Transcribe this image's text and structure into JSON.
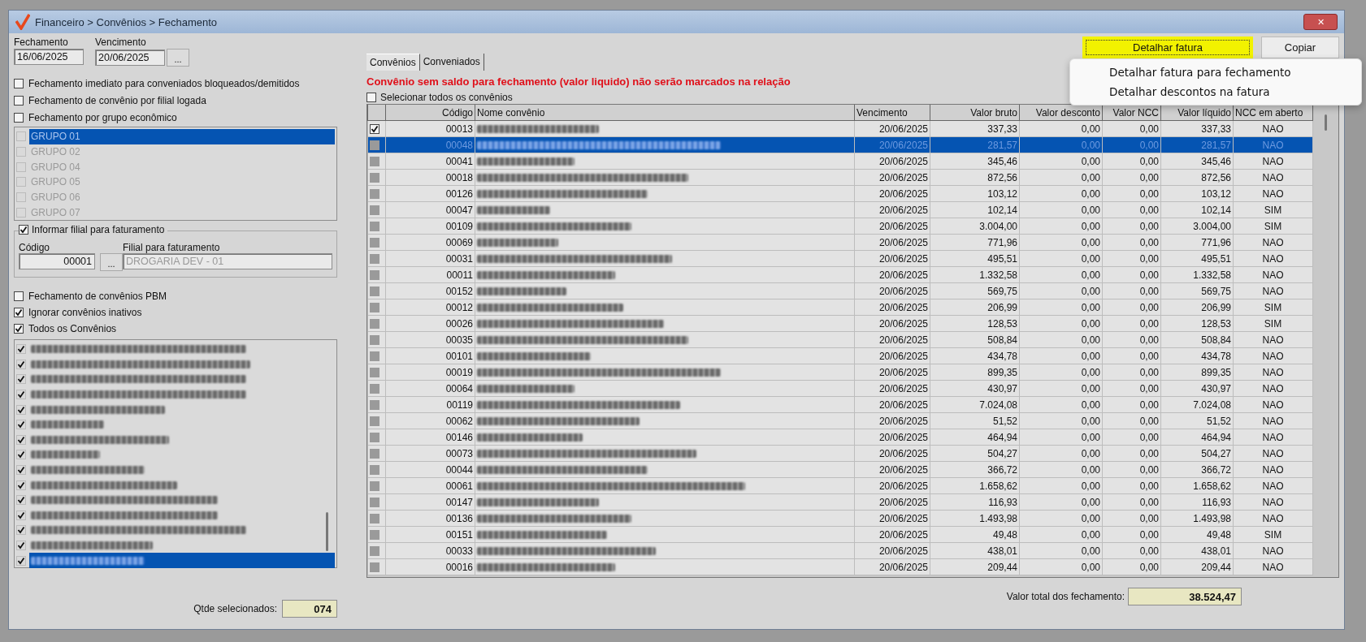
{
  "window": {
    "title": "Financeiro > Convênios > Fechamento",
    "close": "✕"
  },
  "dates": [
    {
      "label": "Fechamento",
      "value": "16/06/2025",
      "has_button": false
    },
    {
      "label": "Vencimento",
      "value": "20/06/2025",
      "has_button": true,
      "button": "..."
    }
  ],
  "options_top": [
    {
      "label": "Fechamento imediato para conveniados bloqueados/demitidos",
      "checked": false
    },
    {
      "label": "Fechamento de convênio por filial logada",
      "checked": false
    },
    {
      "label": "Fechamento por grupo econômico",
      "checked": false
    }
  ],
  "groups": [
    {
      "label": "GRUPO 01",
      "checked": false,
      "selected": true
    },
    {
      "label": "GRUPO 02",
      "checked": false,
      "selected": false
    },
    {
      "label": "GRUPO 04",
      "checked": false,
      "selected": false
    },
    {
      "label": "GRUPO 05",
      "checked": false,
      "selected": false
    },
    {
      "label": "GRUPO 06",
      "checked": false,
      "selected": false
    },
    {
      "label": "GRUPO 07",
      "checked": false,
      "selected": false
    }
  ],
  "filial": {
    "title": "Informar filial para faturamento",
    "checked": true,
    "code_label": "Código",
    "code": "00001",
    "button": "...",
    "name_label": "Filial para faturamento",
    "name": "DROGARIA DEV - 01"
  },
  "options_bottom": [
    {
      "label": "Fechamento de convênios PBM",
      "checked": false
    },
    {
      "label": "Ignorar convênios inativos",
      "checked": true
    },
    {
      "label": "Todos os Convênios",
      "checked": true
    }
  ],
  "convenios_list": [
    {
      "checked": true,
      "selected": false
    },
    {
      "checked": true,
      "selected": false
    },
    {
      "checked": true,
      "selected": false
    },
    {
      "checked": true,
      "selected": false
    },
    {
      "checked": true,
      "selected": false
    },
    {
      "checked": true,
      "selected": false
    },
    {
      "checked": true,
      "selected": false
    },
    {
      "checked": true,
      "selected": false
    },
    {
      "checked": true,
      "selected": false
    },
    {
      "checked": true,
      "selected": false
    },
    {
      "checked": true,
      "selected": false
    },
    {
      "checked": true,
      "selected": false
    },
    {
      "checked": true,
      "selected": false
    },
    {
      "checked": true,
      "selected": false
    },
    {
      "checked": true,
      "selected": true
    }
  ],
  "selected_count": {
    "label": "Qtde selecionados:",
    "value": "074"
  },
  "tabs": [
    {
      "label": "Convênios",
      "selected": true
    },
    {
      "label": "Conveniados",
      "selected": false
    }
  ],
  "buttons": [
    {
      "label": "Detalhar fatura",
      "kind": "highlight"
    },
    {
      "label": "Copiar",
      "kind": "normal"
    }
  ],
  "menu": [
    "Detalhar fatura para fechamento",
    "Detalhar descontos na fatura"
  ],
  "warning": "Convênio sem saldo para fechamento (valor liquido) não serão marcados na relação",
  "select_all": {
    "label": "Selecionar todos os convênios",
    "checked": false
  },
  "table": {
    "columns": [
      "Código",
      "Nome convênio",
      "Vencimento",
      "Valor bruto",
      "Valor desconto",
      "Valor NCC",
      "Valor líquido",
      "NCC em aberto"
    ],
    "rows": [
      {
        "code": "00013",
        "due": "20/06/2025",
        "gross": "337,33",
        "discount": "0,00",
        "ncc": "0,00",
        "net": "337,33",
        "open": "NAO",
        "checked": true,
        "selected": false
      },
      {
        "code": "00048",
        "due": "20/06/2025",
        "gross": "281,57",
        "discount": "0,00",
        "ncc": "0,00",
        "net": "281,57",
        "open": "NAO",
        "checked": false,
        "selected": true
      },
      {
        "code": "00041",
        "due": "20/06/2025",
        "gross": "345,46",
        "discount": "0,00",
        "ncc": "0,00",
        "net": "345,46",
        "open": "NAO",
        "checked": false,
        "selected": false
      },
      {
        "code": "00018",
        "due": "20/06/2025",
        "gross": "872,56",
        "discount": "0,00",
        "ncc": "0,00",
        "net": "872,56",
        "open": "NAO",
        "checked": false,
        "selected": false
      },
      {
        "code": "00126",
        "due": "20/06/2025",
        "gross": "103,12",
        "discount": "0,00",
        "ncc": "0,00",
        "net": "103,12",
        "open": "NAO",
        "checked": false,
        "selected": false
      },
      {
        "code": "00047",
        "due": "20/06/2025",
        "gross": "102,14",
        "discount": "0,00",
        "ncc": "0,00",
        "net": "102,14",
        "open": "SIM",
        "checked": false,
        "selected": false
      },
      {
        "code": "00109",
        "due": "20/06/2025",
        "gross": "3.004,00",
        "discount": "0,00",
        "ncc": "0,00",
        "net": "3.004,00",
        "open": "SIM",
        "checked": false,
        "selected": false
      },
      {
        "code": "00069",
        "due": "20/06/2025",
        "gross": "771,96",
        "discount": "0,00",
        "ncc": "0,00",
        "net": "771,96",
        "open": "NAO",
        "checked": false,
        "selected": false
      },
      {
        "code": "00031",
        "due": "20/06/2025",
        "gross": "495,51",
        "discount": "0,00",
        "ncc": "0,00",
        "net": "495,51",
        "open": "NAO",
        "checked": false,
        "selected": false
      },
      {
        "code": "00011",
        "due": "20/06/2025",
        "gross": "1.332,58",
        "discount": "0,00",
        "ncc": "0,00",
        "net": "1.332,58",
        "open": "NAO",
        "checked": false,
        "selected": false
      },
      {
        "code": "00152",
        "due": "20/06/2025",
        "gross": "569,75",
        "discount": "0,00",
        "ncc": "0,00",
        "net": "569,75",
        "open": "NAO",
        "checked": false,
        "selected": false
      },
      {
        "code": "00012",
        "due": "20/06/2025",
        "gross": "206,99",
        "discount": "0,00",
        "ncc": "0,00",
        "net": "206,99",
        "open": "SIM",
        "checked": false,
        "selected": false
      },
      {
        "code": "00026",
        "due": "20/06/2025",
        "gross": "128,53",
        "discount": "0,00",
        "ncc": "0,00",
        "net": "128,53",
        "open": "SIM",
        "checked": false,
        "selected": false
      },
      {
        "code": "00035",
        "due": "20/06/2025",
        "gross": "508,84",
        "discount": "0,00",
        "ncc": "0,00",
        "net": "508,84",
        "open": "NAO",
        "checked": false,
        "selected": false
      },
      {
        "code": "00101",
        "due": "20/06/2025",
        "gross": "434,78",
        "discount": "0,00",
        "ncc": "0,00",
        "net": "434,78",
        "open": "NAO",
        "checked": false,
        "selected": false
      },
      {
        "code": "00019",
        "due": "20/06/2025",
        "gross": "899,35",
        "discount": "0,00",
        "ncc": "0,00",
        "net": "899,35",
        "open": "NAO",
        "checked": false,
        "selected": false
      },
      {
        "code": "00064",
        "due": "20/06/2025",
        "gross": "430,97",
        "discount": "0,00",
        "ncc": "0,00",
        "net": "430,97",
        "open": "NAO",
        "checked": false,
        "selected": false
      },
      {
        "code": "00119",
        "due": "20/06/2025",
        "gross": "7.024,08",
        "discount": "0,00",
        "ncc": "0,00",
        "net": "7.024,08",
        "open": "NAO",
        "checked": false,
        "selected": false
      },
      {
        "code": "00062",
        "due": "20/06/2025",
        "gross": "51,52",
        "discount": "0,00",
        "ncc": "0,00",
        "net": "51,52",
        "open": "NAO",
        "checked": false,
        "selected": false
      },
      {
        "code": "00146",
        "due": "20/06/2025",
        "gross": "464,94",
        "discount": "0,00",
        "ncc": "0,00",
        "net": "464,94",
        "open": "NAO",
        "checked": false,
        "selected": false
      },
      {
        "code": "00073",
        "due": "20/06/2025",
        "gross": "504,27",
        "discount": "0,00",
        "ncc": "0,00",
        "net": "504,27",
        "open": "NAO",
        "checked": false,
        "selected": false
      },
      {
        "code": "00044",
        "due": "20/06/2025",
        "gross": "366,72",
        "discount": "0,00",
        "ncc": "0,00",
        "net": "366,72",
        "open": "NAO",
        "checked": false,
        "selected": false
      },
      {
        "code": "00061",
        "due": "20/06/2025",
        "gross": "1.658,62",
        "discount": "0,00",
        "ncc": "0,00",
        "net": "1.658,62",
        "open": "NAO",
        "checked": false,
        "selected": false
      },
      {
        "code": "00147",
        "due": "20/06/2025",
        "gross": "116,93",
        "discount": "0,00",
        "ncc": "0,00",
        "net": "116,93",
        "open": "NAO",
        "checked": false,
        "selected": false
      },
      {
        "code": "00136",
        "due": "20/06/2025",
        "gross": "1.493,98",
        "discount": "0,00",
        "ncc": "0,00",
        "net": "1.493,98",
        "open": "NAO",
        "checked": false,
        "selected": false
      },
      {
        "code": "00151",
        "due": "20/06/2025",
        "gross": "49,48",
        "discount": "0,00",
        "ncc": "0,00",
        "net": "49,48",
        "open": "SIM",
        "checked": false,
        "selected": false
      },
      {
        "code": "00033",
        "due": "20/06/2025",
        "gross": "438,01",
        "discount": "0,00",
        "ncc": "0,00",
        "net": "438,01",
        "open": "NAO",
        "checked": false,
        "selected": false
      },
      {
        "code": "00016",
        "due": "20/06/2025",
        "gross": "209,44",
        "discount": "0,00",
        "ncc": "0,00",
        "net": "209,44",
        "open": "NAO",
        "checked": false,
        "selected": false
      }
    ]
  },
  "total": {
    "label": "Valor total dos fechamento:",
    "value": "38.524,47"
  }
}
